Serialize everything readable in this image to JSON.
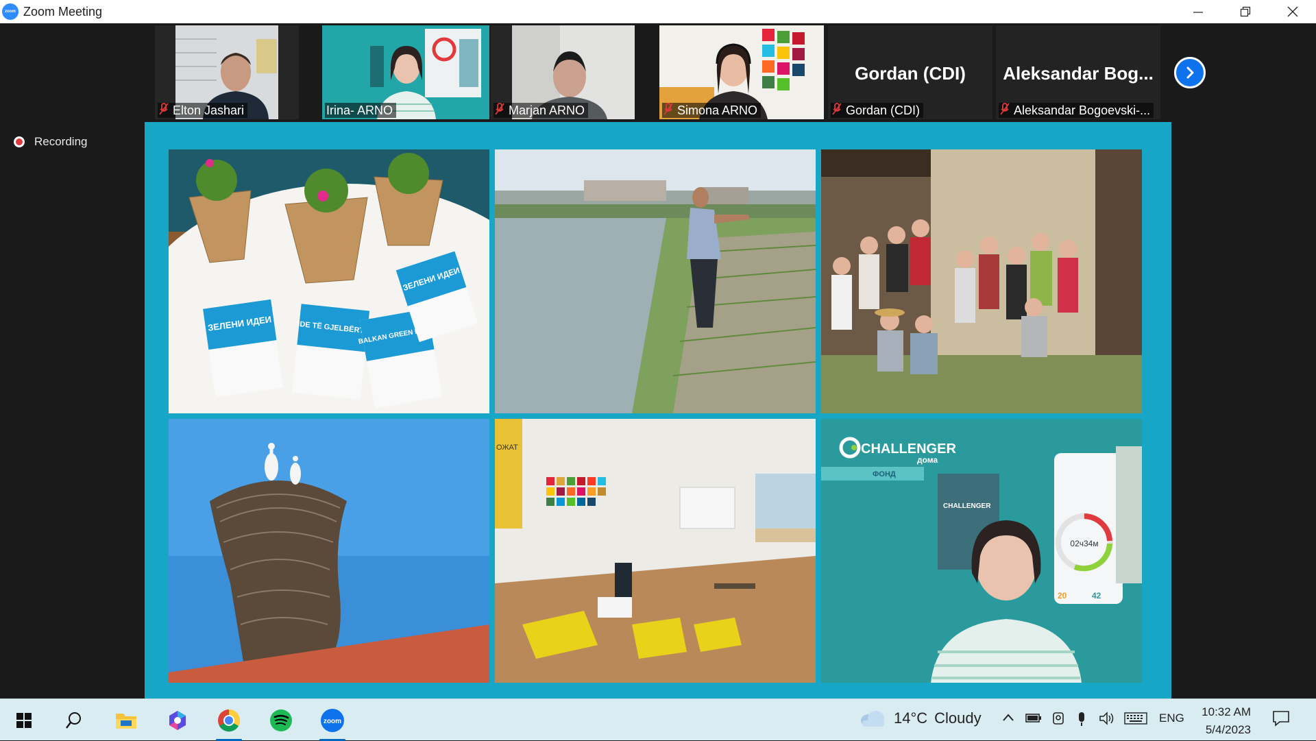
{
  "window": {
    "title": "Zoom Meeting",
    "logo_text": "zoom"
  },
  "participants": [
    {
      "name": "Elton Jashari",
      "muted": true
    },
    {
      "name": "Irina- ARNO",
      "muted": false,
      "active": true
    },
    {
      "name": "Marjan ARNO",
      "muted": true
    },
    {
      "name": "Simona ARNO",
      "muted": true
    },
    {
      "name": "Gordan (CDI)",
      "display": "Gordan (CDI)",
      "muted": true
    },
    {
      "name": "Aleksandar Bogoevski-...",
      "display": "Aleksandar  Bog...",
      "muted": true
    }
  ],
  "recording": {
    "label": "Recording"
  },
  "shared_screen": {
    "booklets": [
      "ЗЕЛЕНИ ИДЕИ",
      "IDE TË GJELBËRTA",
      "BALKAN GREEN IDEAS",
      "ЗЕЛЕНИ ИДЕИ"
    ],
    "challenger": {
      "title": "CHALLENGER",
      "subtitle": "дома",
      "fund": "ФОНД",
      "timer": "02ч34м",
      "count1": "20",
      "count2": "42"
    },
    "office_sign": "ОЖАТ"
  },
  "taskbar": {
    "weather": {
      "temp": "14°C",
      "condition": "Cloudy"
    },
    "language": "ENG",
    "time": "10:32 AM",
    "date": "5/4/2023",
    "apps": [
      "start-icon",
      "search-icon",
      "file-explorer-icon",
      "copilot-icon",
      "chrome-icon",
      "spotify-icon",
      "zoom-icon"
    ]
  },
  "colors": {
    "share_bg": "#17a6c5",
    "zoom_blue": "#0e72ed",
    "active_border": "#c8e23c",
    "muted_red": "#e0393e"
  }
}
